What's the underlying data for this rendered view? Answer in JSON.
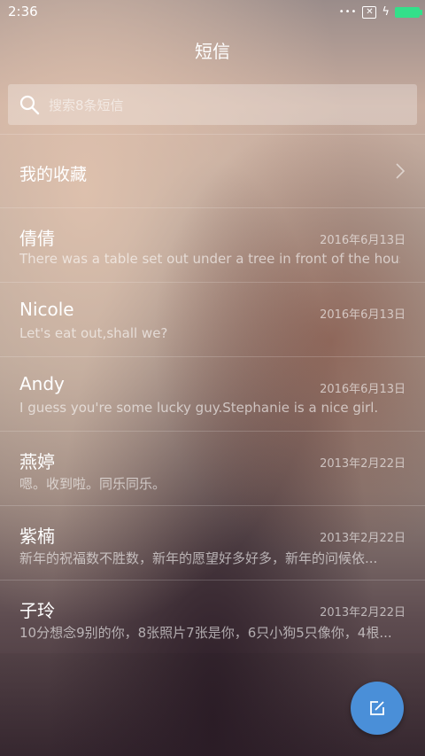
{
  "status_bar": {
    "time": "2:36",
    "sim_icon": "sim-card-x-icon",
    "battery_color": "#33e08a"
  },
  "header": {
    "title": "短信"
  },
  "search": {
    "placeholder": "搜索8条短信"
  },
  "favorites": {
    "label": "我的收藏"
  },
  "conversations": [
    {
      "name": "倩倩",
      "date": "2016年6月13日",
      "preview": "There was a table set out under a tree in front of the hous"
    },
    {
      "name": "Nicole",
      "date": "2016年6月13日",
      "preview": "Let's eat out,shall we?"
    },
    {
      "name": "Andy",
      "date": "2016年6月13日",
      "preview": "I guess you're some lucky guy.Stephanie is a nice girl."
    },
    {
      "name": "燕婷",
      "date": "2013年2月22日",
      "preview": "嗯。收到啦。同乐同乐。"
    },
    {
      "name": "紫楠",
      "date": "2013年2月22日",
      "preview": "新年的祝福数不胜数，新年的愿望好多好多，新年的问候依..."
    },
    {
      "name": "子玲",
      "date": "2013年2月22日",
      "preview": "10分想念9别的你，8张照片7张是你，6只小狗5只像你，4根..."
    }
  ],
  "compose": {
    "icon": "compose-icon",
    "color": "#4a8fd8"
  }
}
